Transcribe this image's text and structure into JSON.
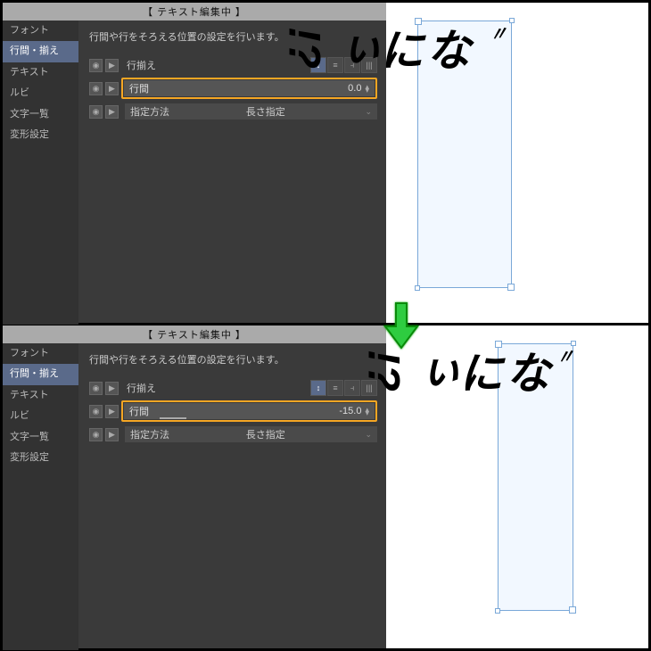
{
  "panel_title": "【 テキスト編集中 】",
  "sidebar": {
    "items": [
      {
        "label": "フォント"
      },
      {
        "label": "行間・揃え"
      },
      {
        "label": "テキスト"
      },
      {
        "label": "ルビ"
      },
      {
        "label": "文字一覧"
      },
      {
        "label": "変形設定"
      }
    ],
    "active_index": 1
  },
  "description": "行間や行をそろえる位置の設定を行います。",
  "rows": {
    "align": {
      "label": "行揃え"
    },
    "spacing": {
      "label": "行間"
    },
    "method": {
      "label": "指定方法",
      "value": "長さ指定"
    }
  },
  "top": {
    "spacing_value": "0.0"
  },
  "bottom": {
    "spacing_value": "-15.0"
  },
  "text_chars": [
    "な",
    "に",
    "ぃ",
    "!?"
  ],
  "dakuten": "〃"
}
